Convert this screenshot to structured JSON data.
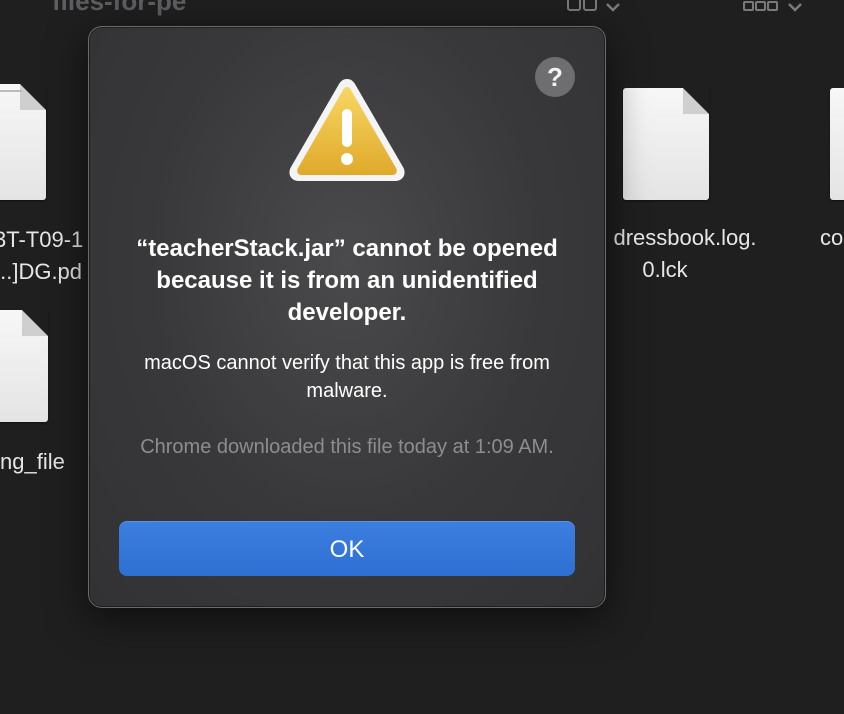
{
  "window": {
    "title": "files-for-pe"
  },
  "toolbar": {
    "view_icon": "grid-view-icon",
    "group_icon": "group-view-icon",
    "chevron": "chevron-down-icon"
  },
  "files": [
    {
      "label_line1": "3T-T09-1",
      "label_line2": "...]DG.pd",
      "icon": "document-icon"
    },
    {
      "label_line1": "ng_file",
      "label_line2": "",
      "icon": "document-icon"
    },
    {
      "label_line1": "dressbook.log.",
      "label_line2": "0.lck",
      "icon": "document-icon"
    },
    {
      "label_line1": "co",
      "label_line2": "",
      "icon": "document-icon"
    }
  ],
  "dialog": {
    "help_label": "?",
    "icon": "warning-icon",
    "title": "“teacherStack.jar” cannot be opened because it is from an unidentified developer.",
    "message": "macOS cannot verify that this app is free from malware.",
    "info": "Chrome downloaded this file today at 1:09 AM.",
    "ok_label": "OK"
  },
  "colors": {
    "accent": "#2f6fd3",
    "warning_yellow": "#f2c53d",
    "dialog_bg": "#3a3a3c"
  }
}
